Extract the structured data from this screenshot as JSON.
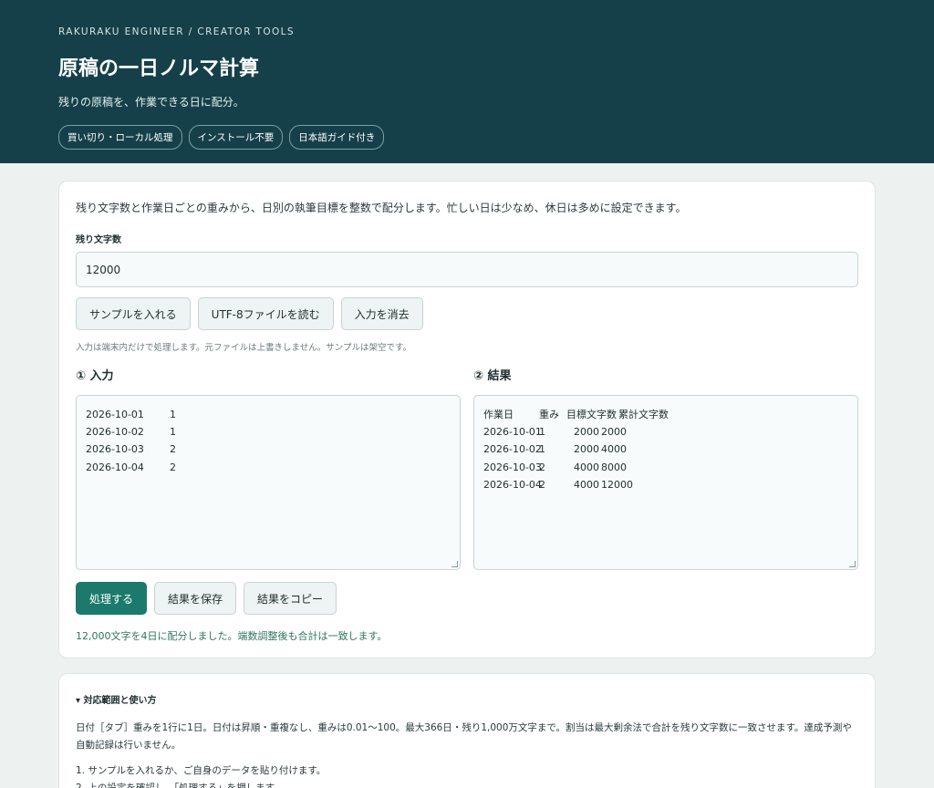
{
  "header": {
    "eyebrow": "RAKURAKU ENGINEER / CREATOR TOOLS",
    "title": "原稿の一日ノルマ計算",
    "subtitle": "残りの原稿を、作業できる日に配分。",
    "chips": [
      "買い切り・ローカル処理",
      "インストール不要",
      "日本語ガイド付き"
    ]
  },
  "main": {
    "intro": "残り文字数と作業日ごとの重みから、日別の執筆目標を整数で配分します。忙しい日は少なめ、休日は多めに設定できます。",
    "remaining_label": "残り文字数",
    "remaining_value": "12000",
    "buttons": {
      "sample": "サンプルを入れる",
      "read_file": "UTF-8ファイルを読む",
      "clear": "入力を消去"
    },
    "note": "入力は端末内だけで処理します。元ファイルは上書きしません。サンプルは架空です。",
    "input_heading": "① 入力",
    "result_heading": "② 結果",
    "input_rows": [
      {
        "date": "2026-10-01",
        "weight": "1"
      },
      {
        "date": "2026-10-02",
        "weight": "1"
      },
      {
        "date": "2026-10-03",
        "weight": "2"
      },
      {
        "date": "2026-10-04",
        "weight": "2"
      }
    ],
    "result_header": {
      "date": "作業日",
      "weight": "重み",
      "target": "目標文字数",
      "cumulative": "累計文字数"
    },
    "result_rows": [
      {
        "date": "2026-10-01",
        "weight": "1",
        "target": "2000",
        "cumulative": "2000"
      },
      {
        "date": "2026-10-02",
        "weight": "1",
        "target": "2000",
        "cumulative": "4000"
      },
      {
        "date": "2026-10-03",
        "weight": "2",
        "target": "4000",
        "cumulative": "8000"
      },
      {
        "date": "2026-10-04",
        "weight": "2",
        "target": "4000",
        "cumulative": "12000"
      }
    ],
    "actions": {
      "process": "処理する",
      "save": "結果を保存",
      "copy": "結果をコピー"
    },
    "status": "12,000文字を4日に配分しました。端数調整後も合計は一致します。"
  },
  "help": {
    "summary": "▾ 対応範囲と使い方",
    "text": "日付［タブ］重みを1行に1日。日付は昇順・重複なし、重みは0.01〜100。最大366日・残り1,000万文字まで。割当は最大剰余法で合計を残り文字数に一致させます。達成予測や自動記録は行いません。",
    "steps": [
      "1. サンプルを入れるか、ご自身のデータを貼り付けます。",
      "2. 上の設定を確認し、「処理する」を押します。"
    ]
  },
  "colors": {
    "header_bg": "#15404a",
    "primary": "#1b7a6b",
    "status": "#2f7560"
  }
}
